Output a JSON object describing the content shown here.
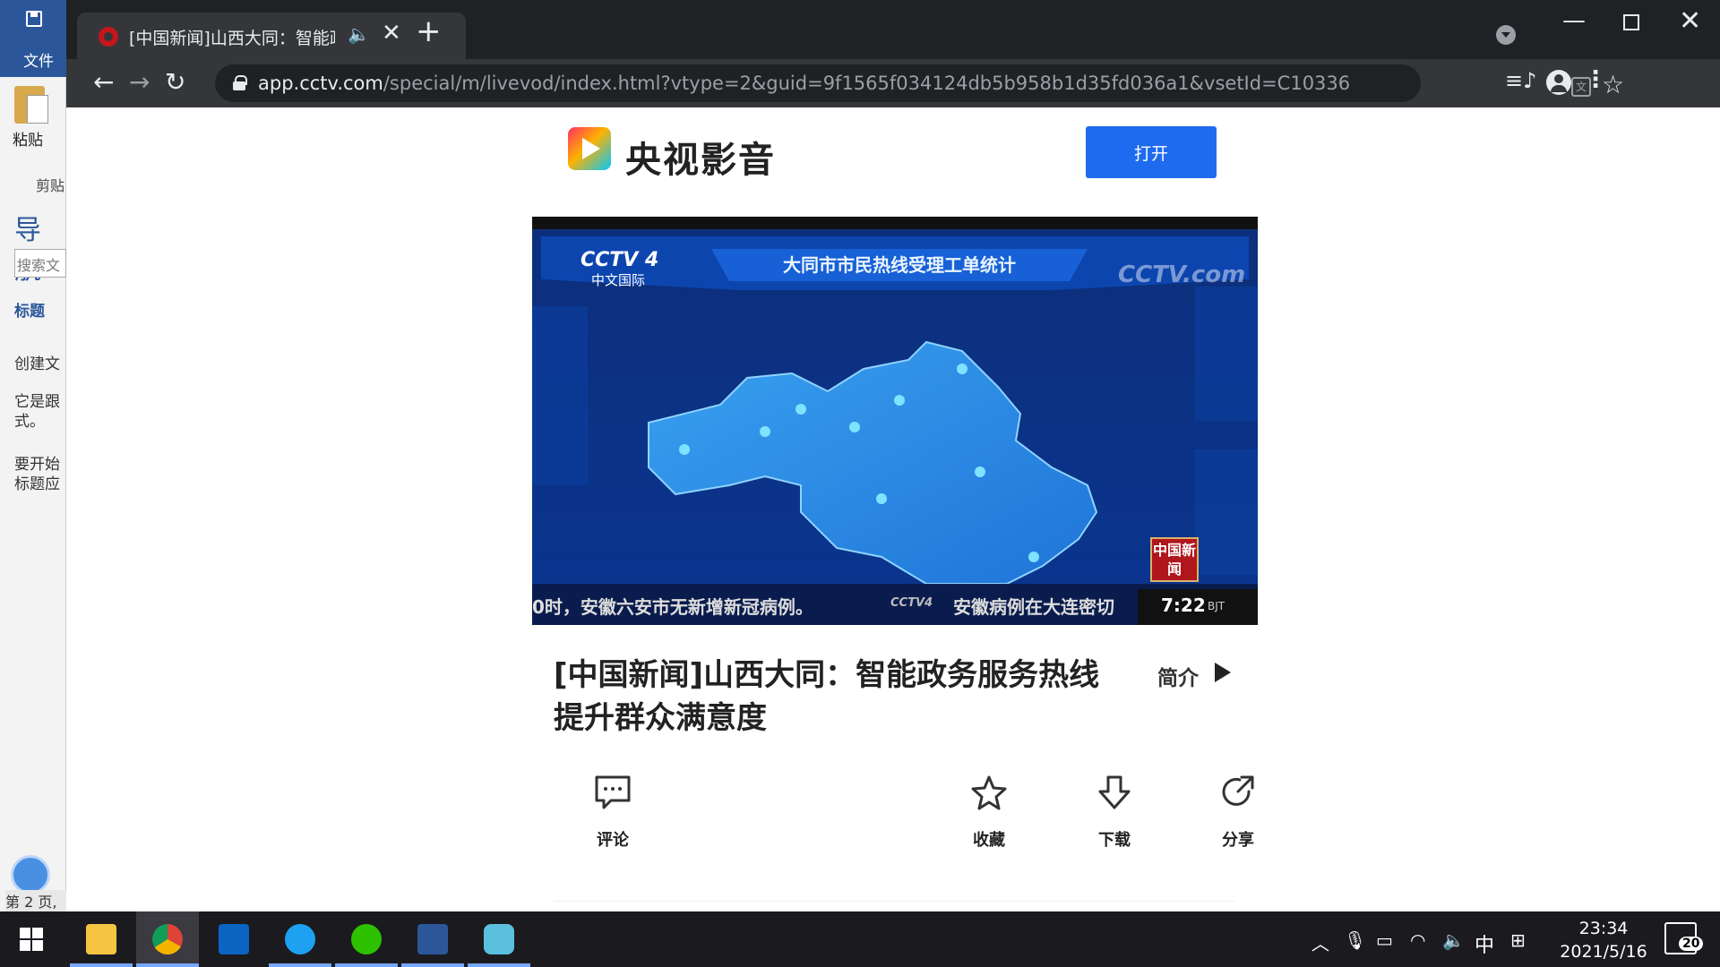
{
  "word": {
    "file_label": "文件",
    "paste_label": "粘贴",
    "clipboard_label": "剪贴",
    "nav_title": "导航",
    "search_placeholder": "搜索文",
    "headings_label": "标题",
    "para1": "创建文",
    "para2": "它是跟式。",
    "para3": "要开始标题应",
    "page_status": "第 2 页,"
  },
  "browser": {
    "tab_title": "[中国新闻]山西大同：智能政",
    "url_host": "app.cctv.com",
    "url_path": "/special/m/livevod/index.html?vtype=2&guid=9f1565f034124db5b958b1d35fd036a1&vsetId=C10336"
  },
  "page": {
    "logo_text": "央视影音",
    "open_button": "打开",
    "video": {
      "channel": "CCTV 4",
      "channel_sub": "中文国际",
      "watermark": "CCTV.com",
      "banner": "大同市市民热线受理工单统计",
      "ticker_left": "0时，安徽六安市无新增新冠病例。",
      "ticker_logo": "CCTV4",
      "ticker_right": "安徽病例在大连密切",
      "time": "7:22",
      "time_zone": "BJT",
      "news_badge": "中国新闻"
    },
    "title": "[中国新闻]山西大同：智能政务服务热线提升群众满意度",
    "intro_label": "简介",
    "actions": {
      "comment": "评论",
      "favorite": "收藏",
      "download": "下载",
      "share": "分享"
    }
  },
  "taskbar": {
    "ime": "中",
    "time": "23:34",
    "date": "2021/5/16",
    "notifications": "20"
  }
}
